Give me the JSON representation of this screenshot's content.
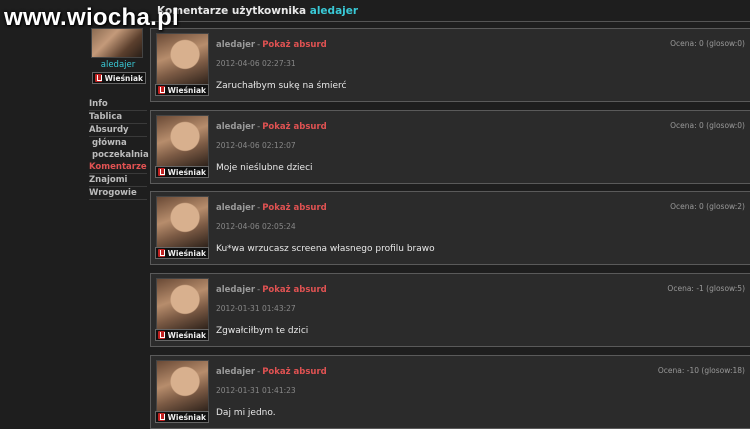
{
  "watermark": "www.wiocha.pl",
  "header": {
    "title_prefix": "Komentarze użytkownika",
    "username": "aledajer"
  },
  "sidebar": {
    "username": "aledajer",
    "badge": "Wieśniak",
    "nav": [
      {
        "label": "Info",
        "active": false,
        "sub": false
      },
      {
        "label": "Tablica",
        "active": false,
        "sub": false
      },
      {
        "label": "Absurdy",
        "active": false,
        "sub": false
      },
      {
        "label": "główna",
        "active": false,
        "sub": true
      },
      {
        "label": "poczekalnia",
        "active": false,
        "sub": true
      },
      {
        "label": "Komentarze",
        "active": true,
        "sub": false
      },
      {
        "label": "Znajomi",
        "active": false,
        "sub": false
      },
      {
        "label": "Wrogowie",
        "active": false,
        "sub": false
      }
    ]
  },
  "comments": [
    {
      "author": "aledajer",
      "sep": "-",
      "action": "Pokaż absurd",
      "date": "2012-04-06 02:27:31",
      "rating": "Ocena: 0 (glosow:0)",
      "text": "Zaruchałbym sukę na śmierć",
      "badge": "Wieśniak"
    },
    {
      "author": "aledajer",
      "sep": "-",
      "action": "Pokaż absurd",
      "date": "2012-04-06 02:12:07",
      "rating": "Ocena: 0 (glosow:0)",
      "text": "Moje nieślubne dzieci",
      "badge": "Wieśniak"
    },
    {
      "author": "aledajer",
      "sep": "-",
      "action": "Pokaż absurd",
      "date": "2012-04-06 02:05:24",
      "rating": "Ocena: 0 (glosow:2)",
      "text": "Ku*wa wrzucasz screena własnego profilu brawo",
      "badge": "Wieśniak"
    },
    {
      "author": "aledajer",
      "sep": "-",
      "action": "Pokaż absurd",
      "date": "2012-01-31 01:43:27",
      "rating": "Ocena: -1 (glosow:5)",
      "text": "Zgwałciłbym te dzici",
      "badge": "Wieśniak"
    },
    {
      "author": "aledajer",
      "sep": "-",
      "action": "Pokaż absurd",
      "date": "2012-01-31 01:41:23",
      "rating": "Ocena: -10 (glosow:18)",
      "text": "Daj mi jedno.",
      "badge": "Wieśniak"
    }
  ]
}
